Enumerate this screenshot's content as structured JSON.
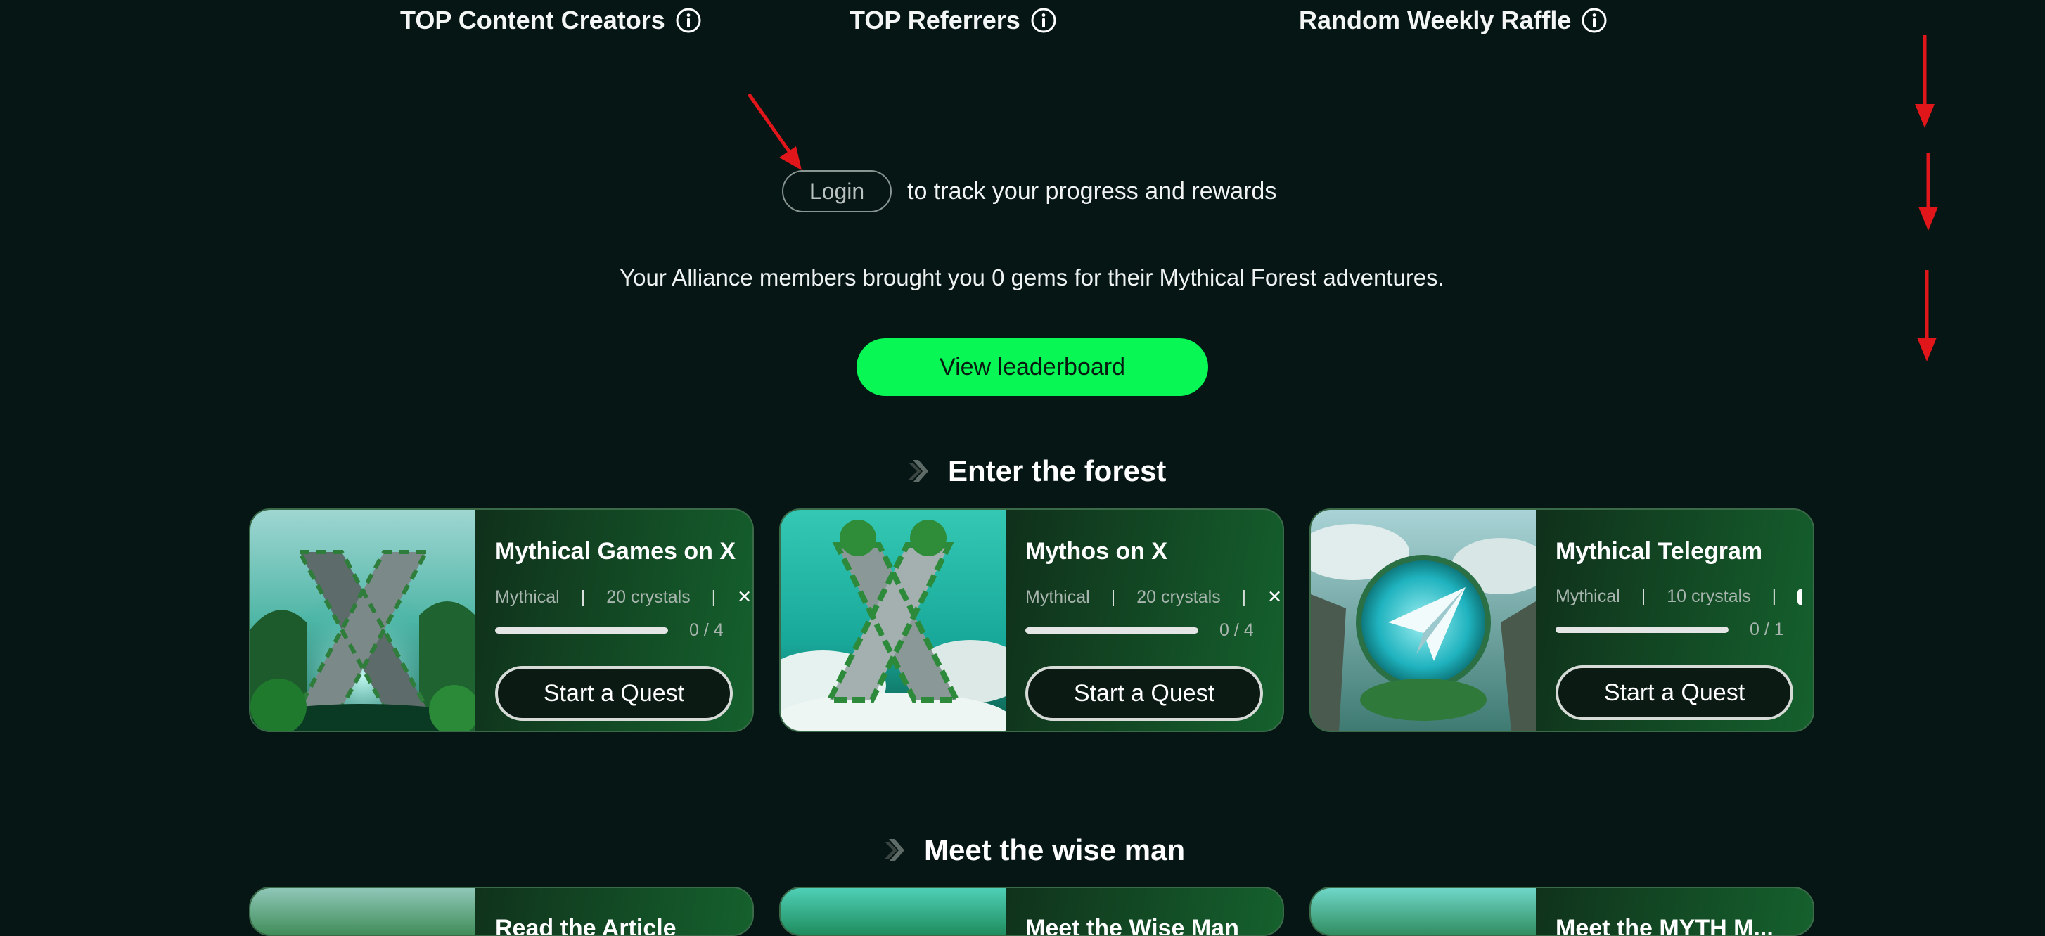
{
  "top_tabs": [
    {
      "label": "TOP Content Creators"
    },
    {
      "label": "TOP Referrers"
    },
    {
      "label": "Random Weekly Raffle"
    }
  ],
  "login": {
    "button_label": "Login",
    "text": "to track your progress and rewards"
  },
  "alliance_text": "Your Alliance members brought you 0 gems for their Mythical Forest adventures.",
  "leaderboard_button": "View leaderboard",
  "sections": [
    {
      "title": "Enter the forest",
      "cards": [
        {
          "title": "Mythical Games on X",
          "tier": "Mythical",
          "separator": "|",
          "reward": "20 crystals",
          "progress_text": "0 / 4",
          "progress": 0,
          "button": "Start a Quest",
          "image_icon": "x-logo-forest"
        },
        {
          "title": "Mythos on X",
          "tier": "Mythical",
          "separator": "|",
          "reward": "20 crystals",
          "progress_text": "0 / 4",
          "progress": 0,
          "button": "Start a Quest",
          "image_icon": "x-logo-clouds"
        },
        {
          "title": "Mythical Telegram",
          "tier": "Mythical",
          "separator": "|",
          "reward": "10 crystals",
          "progress_text": "0 / 1",
          "progress": 0,
          "button": "Start a Quest",
          "image_icon": "telegram-plane"
        }
      ]
    },
    {
      "title": "Meet the wise man",
      "cards": [
        {
          "title": "Read the Article"
        },
        {
          "title": "Meet the Wise Man"
        },
        {
          "title": "Meet the MYTH M..."
        }
      ]
    }
  ],
  "colors": {
    "background": "#051615",
    "accent_green": "#08f755",
    "annotation_red": "#e0161b"
  }
}
